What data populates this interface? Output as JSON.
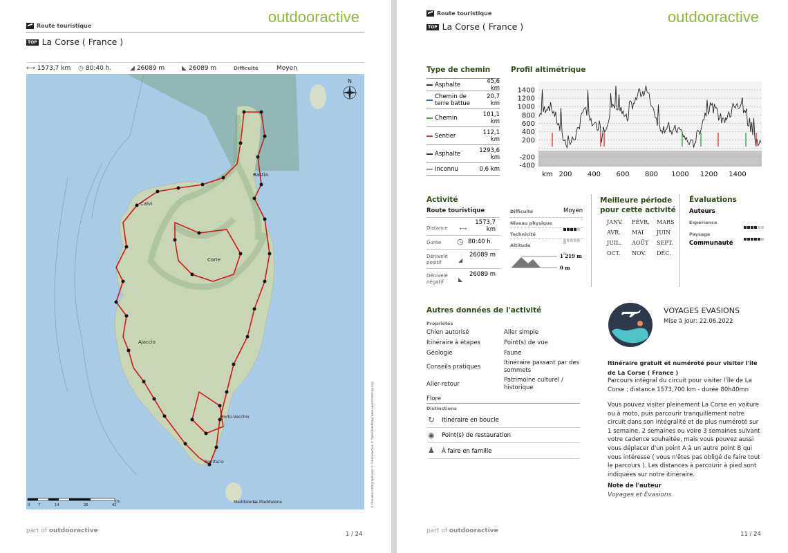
{
  "brand": "outdooractive",
  "page1": {
    "category": "Route touristique",
    "badge": "TOP",
    "title": "La Corse ( France )",
    "stats": {
      "distance": "1573,7 km",
      "duration": "80:40 h.",
      "ascent": "26089 m",
      "descent": "26089 m",
      "difficulty_label": "Difficulté",
      "difficulty": "Moyen"
    },
    "map": {
      "places": [
        "Calvi",
        "Bastia",
        "Corte",
        "Ajaccio",
        "Porto-Vecchio",
        "Bonifacio",
        "Maddalena",
        "La Maddalena"
      ],
      "scale_labels": [
        "0",
        "7",
        "14",
        "28",
        "42",
        "km"
      ],
      "attribution": "© Données cartographiques © Outdooractive © OpenStreetMap (www.openstreetmap.org)"
    },
    "footer_part": "part of",
    "footer_brand": "outdooractive",
    "page_number": "1 / 24"
  },
  "page2": {
    "category": "Route touristique",
    "badge": "TOP",
    "title": "La Corse ( France )",
    "type_chemin": {
      "heading": "Type de chemin",
      "rows": [
        {
          "label": "Asphalte",
          "value": "45,6 km",
          "color": "#333333"
        },
        {
          "label": "Chemin de terre battue",
          "value": "20,7 km",
          "color": "#3a5fa8"
        },
        {
          "label": "Chemin",
          "value": "101,1 km",
          "color": "#3fa33f"
        },
        {
          "label": "Sentier",
          "value": "112,1 km",
          "color": "#e03c3c"
        },
        {
          "label": "Asphalte",
          "value": "1293,6 km",
          "color": "#333333"
        },
        {
          "label": "Inconnu",
          "value": "0,6 km",
          "color": "#999999"
        }
      ]
    },
    "profil": {
      "heading": "Profil altimétrique",
      "y_ticks": [
        "1400",
        "1200",
        "1000",
        "800",
        "600",
        "400",
        "200",
        "",
        "-200",
        "-400"
      ],
      "x_ticks": [
        "km",
        "200",
        "400",
        "600",
        "800",
        "1000",
        "1200",
        "1400"
      ]
    },
    "activite": {
      "heading": "Activité",
      "subtitle": "Route touristique",
      "distance_label": "Distance",
      "distance": "1573,7 km",
      "duree_label": "Durée",
      "duree": "80:40 h.",
      "denivele_pos_label": "Dénivelé positif",
      "denivele_pos": "26089 m",
      "denivele_neg_label": "Dénivelé négatif",
      "denivele_neg": "26089 m",
      "difficulte_label": "Difficulté",
      "difficulte": "Moyen",
      "niveau_label": "Niveau physique",
      "niveau_level": 4,
      "technicite_label": "Technicité",
      "technicite_level": 0,
      "altitude_label": "Altitude",
      "alt_max": "1 219 m",
      "alt_min": "0 m"
    },
    "periode": {
      "heading_1": "Meilleure période",
      "heading_2": "pour cette activité",
      "months": [
        "JANV.",
        "FÉVR.",
        "MARS",
        "AVR.",
        "MAI",
        "JUIN",
        "JUIL.",
        "AOÛT",
        "SEPT.",
        "OCT.",
        "NOV.",
        "DÉC."
      ]
    },
    "evaluations": {
      "heading": "Évaluations",
      "auteurs": "Auteurs",
      "experience_label": "Expérience",
      "experience_level": 4,
      "paysage_label": "Paysage",
      "paysage_level": 5,
      "communaute": "Communauté"
    },
    "autres": {
      "heading": "Autres données de l'activité",
      "proprietes_label": "Propriétés",
      "left_items": [
        "Chien autorisé",
        "Itinéraire à étapes",
        "Géologie",
        "Conseils pratiques",
        "Aller-retour",
        "Flore"
      ],
      "right_items": [
        "Aller simple",
        "Point(s) de vue",
        "Faune",
        "Itinéraire passant par des sommets",
        "Patrimoine culturel / historique"
      ],
      "distinctions_label": "Distinctions",
      "distinctions": [
        "Itinéraire en boucle",
        "Point(s) de restauration",
        "À faire en famille"
      ]
    },
    "author": {
      "name": "VOYAGES EVASIONS",
      "updated": "Mise à jour: 22.06.2022",
      "summary_bold": "Itinéraire gratuit et numéroté pour visiter l'île de La Corse ( France )",
      "summary": "Parcours intégral du circuit pour visiter l'île de La Corse : distance 1573,700 km - durée 80h40mn",
      "body": "Vous pouvez visiter pleinement La Corse en voiture ou à moto, puis parcourir tranquillement notre circuit dans son intégralité et de plus numéroté sur 1 semaine, 2 semaines ou voire 3 semaines suivant votre cadence souhaitée, mais vous pouvez aussi vous déplacer d'un point A à un autre point B qui vous intéresse ( vous n'êtes pas obligé de faire tout le parcours ). Les distances à parcourir à pied sont indiquées sur notre itinéraire.",
      "note_label": "Note de l'auteur",
      "note": "Voyages et Evasions"
    },
    "footer_part": "part of",
    "footer_brand": "outdooractive",
    "page_number": "11 / 24"
  }
}
